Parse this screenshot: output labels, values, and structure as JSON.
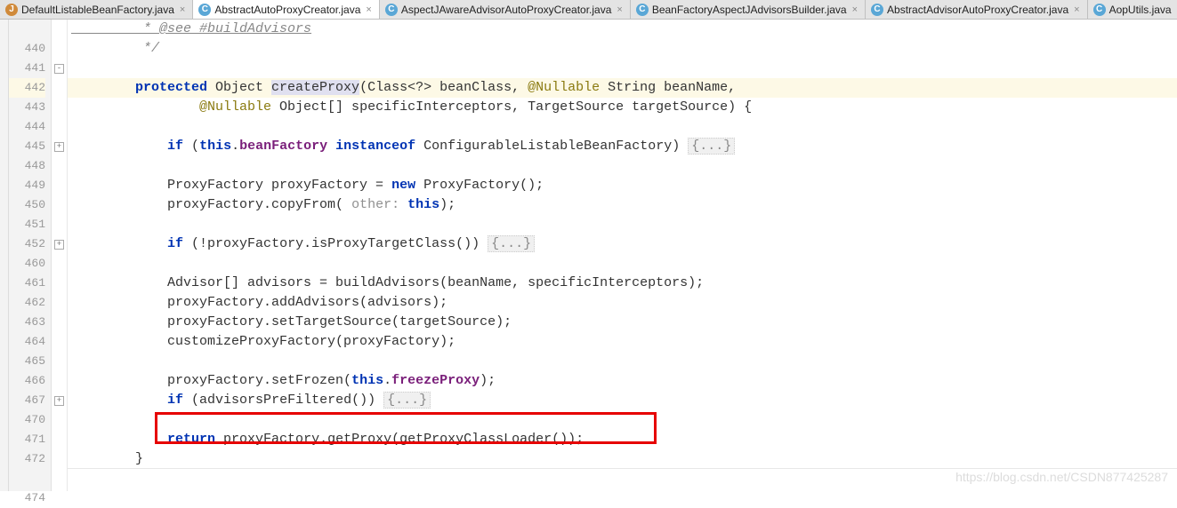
{
  "tabs": [
    {
      "label": "DefaultListableBeanFactory.java",
      "icon": "j",
      "active": false
    },
    {
      "label": "AbstractAutoProxyCreator.java",
      "icon": "c",
      "active": true
    },
    {
      "label": "AspectJAwareAdvisorAutoProxyCreator.java",
      "icon": "c",
      "active": false
    },
    {
      "label": "BeanFactoryAspectJAdvisorsBuilder.java",
      "icon": "c",
      "active": false
    },
    {
      "label": "AbstractAdvisorAutoProxyCreator.java",
      "icon": "c",
      "active": false
    },
    {
      "label": "AopUtils.java",
      "icon": "c",
      "active": false
    }
  ],
  "line_numbers": [
    "",
    "440",
    "441",
    "442",
    "443",
    "444",
    "445",
    "448",
    "449",
    "450",
    "451",
    "452",
    "460",
    "461",
    "462",
    "463",
    "464",
    "465",
    "466",
    "467",
    "470",
    "471",
    "472",
    "",
    "474"
  ],
  "fold_marks": {
    "1": "-",
    "2": "-",
    "6": "+",
    "11": "+",
    "19": "+"
  },
  "code": {
    "l0": "         * @see #buildAdvisors",
    "l1": "         */",
    "l2a": "        ",
    "l2_kw_protected": "protected",
    "l2b": " Object ",
    "l2_method": "createProxy",
    "l2c": "(Class<?> beanClass, ",
    "l2_ann": "@Nullable",
    "l2d": " String beanName,",
    "l3a": "                ",
    "l3_ann": "@Nullable",
    "l3b": " Object[] specificInterceptors, TargetSource targetSource) {",
    "l4": "",
    "l5a": "            ",
    "l5_if": "if",
    "l5b": " (",
    "l5_this": "this",
    "l5c": ".",
    "l5_field": "beanFactory",
    "l5d": " ",
    "l5_inst": "instanceof",
    "l5e": " ConfigurableListableBeanFactory) ",
    "l5_fold": "{...}",
    "l6": "",
    "l7a": "            ProxyFactory proxyFactory = ",
    "l7_new": "new",
    "l7b": " ProxyFactory();",
    "l8a": "            proxyFactory.copyFrom( ",
    "l8_hint": "other:",
    "l8b": " ",
    "l8_this": "this",
    "l8c": ");",
    "l9": "",
    "l10a": "            ",
    "l10_if": "if",
    "l10b": " (!proxyFactory.isProxyTargetClass()) ",
    "l10_fold": "{...}",
    "l11": "",
    "l12": "            Advisor[] advisors = buildAdvisors(beanName, specificInterceptors);",
    "l13": "            proxyFactory.addAdvisors(advisors);",
    "l14": "            proxyFactory.setTargetSource(targetSource);",
    "l15": "            customizeProxyFactory(proxyFactory);",
    "l16": "",
    "l17a": "            proxyFactory.setFrozen(",
    "l17_this": "this",
    "l17b": ".",
    "l17_field": "freezeProxy",
    "l17c": ");",
    "l18a": "            ",
    "l18_if": "if",
    "l18b": " (advisorsPreFiltered()) ",
    "l18_fold": "{...}",
    "l19": "",
    "l20a": "            ",
    "l20_ret": "return",
    "l20b": " proxyFactory.getProxy(getProxyClassLoader());",
    "l21": "        }",
    "l22": "",
    "l23": "        /**"
  },
  "watermark": "https://blog.csdn.net/CSDN877425287"
}
